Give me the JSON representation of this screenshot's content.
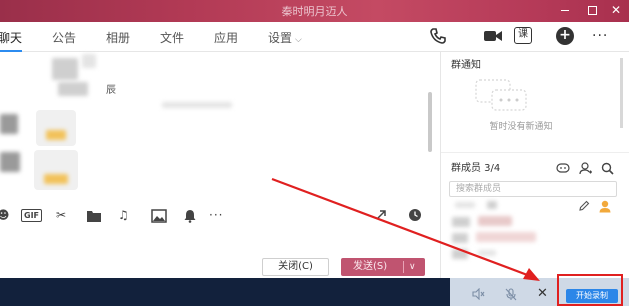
{
  "window": {
    "title": "秦时明月迈人",
    "close_glyph": "✕"
  },
  "tabs": [
    {
      "label": "聊天",
      "active": true
    },
    {
      "label": "公告",
      "active": false
    },
    {
      "label": "相册",
      "active": false
    },
    {
      "label": "文件",
      "active": false
    },
    {
      "label": "应用",
      "active": false
    },
    {
      "label": "设置",
      "active": false,
      "dropdown": true
    }
  ],
  "tab_chevron": "⌵",
  "top_actions": {
    "course_label": "课",
    "plus_label": "+",
    "more_label": "···"
  },
  "chat": {
    "sender_suffix": "辰"
  },
  "toolbar": {
    "gif_label": "GIF",
    "more_label": "···"
  },
  "buttons": {
    "close_label": "关闭(C)",
    "send_label": "发送(S)",
    "send_caret": "∨"
  },
  "notice": {
    "title": "群通知",
    "empty_text": "暂时没有新通知"
  },
  "members": {
    "title": "群成员 3/4",
    "search_placeholder": "搜索群成员"
  },
  "recorder": {
    "start_label": "开始录制",
    "close_glyph": "✕"
  },
  "colors": {
    "title_bar": "#b23a55",
    "tab_active_underline": "#2c8cf0",
    "send_button": "#c05470",
    "taskbar": "#12213c",
    "record_button": "#2c86e8",
    "annotation_red": "#e02020"
  }
}
